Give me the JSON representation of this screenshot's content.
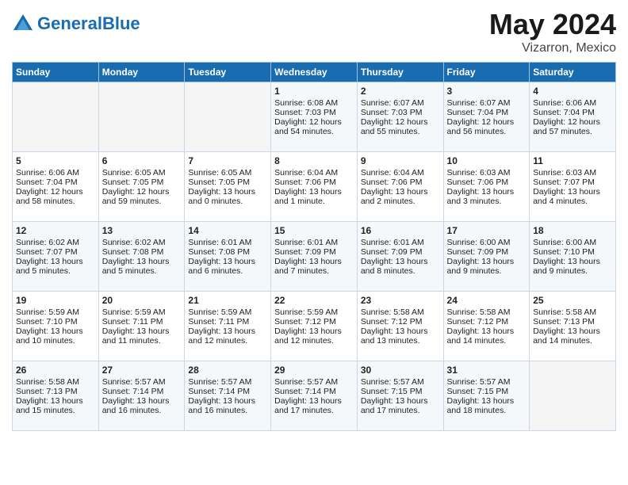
{
  "header": {
    "logo_general": "General",
    "logo_blue": "Blue",
    "month": "May 2024",
    "location": "Vizarron, Mexico"
  },
  "days_of_week": [
    "Sunday",
    "Monday",
    "Tuesday",
    "Wednesday",
    "Thursday",
    "Friday",
    "Saturday"
  ],
  "weeks": [
    [
      {
        "day": "",
        "sunrise": "",
        "sunset": "",
        "daylight": "",
        "empty": true
      },
      {
        "day": "",
        "sunrise": "",
        "sunset": "",
        "daylight": "",
        "empty": true
      },
      {
        "day": "",
        "sunrise": "",
        "sunset": "",
        "daylight": "",
        "empty": true
      },
      {
        "day": "1",
        "sunrise": "Sunrise: 6:08 AM",
        "sunset": "Sunset: 7:03 PM",
        "daylight": "Daylight: 12 hours and 54 minutes."
      },
      {
        "day": "2",
        "sunrise": "Sunrise: 6:07 AM",
        "sunset": "Sunset: 7:03 PM",
        "daylight": "Daylight: 12 hours and 55 minutes."
      },
      {
        "day": "3",
        "sunrise": "Sunrise: 6:07 AM",
        "sunset": "Sunset: 7:04 PM",
        "daylight": "Daylight: 12 hours and 56 minutes."
      },
      {
        "day": "4",
        "sunrise": "Sunrise: 6:06 AM",
        "sunset": "Sunset: 7:04 PM",
        "daylight": "Daylight: 12 hours and 57 minutes."
      }
    ],
    [
      {
        "day": "5",
        "sunrise": "Sunrise: 6:06 AM",
        "sunset": "Sunset: 7:04 PM",
        "daylight": "Daylight: 12 hours and 58 minutes."
      },
      {
        "day": "6",
        "sunrise": "Sunrise: 6:05 AM",
        "sunset": "Sunset: 7:05 PM",
        "daylight": "Daylight: 12 hours and 59 minutes."
      },
      {
        "day": "7",
        "sunrise": "Sunrise: 6:05 AM",
        "sunset": "Sunset: 7:05 PM",
        "daylight": "Daylight: 13 hours and 0 minutes."
      },
      {
        "day": "8",
        "sunrise": "Sunrise: 6:04 AM",
        "sunset": "Sunset: 7:06 PM",
        "daylight": "Daylight: 13 hours and 1 minute."
      },
      {
        "day": "9",
        "sunrise": "Sunrise: 6:04 AM",
        "sunset": "Sunset: 7:06 PM",
        "daylight": "Daylight: 13 hours and 2 minutes."
      },
      {
        "day": "10",
        "sunrise": "Sunrise: 6:03 AM",
        "sunset": "Sunset: 7:06 PM",
        "daylight": "Daylight: 13 hours and 3 minutes."
      },
      {
        "day": "11",
        "sunrise": "Sunrise: 6:03 AM",
        "sunset": "Sunset: 7:07 PM",
        "daylight": "Daylight: 13 hours and 4 minutes."
      }
    ],
    [
      {
        "day": "12",
        "sunrise": "Sunrise: 6:02 AM",
        "sunset": "Sunset: 7:07 PM",
        "daylight": "Daylight: 13 hours and 5 minutes."
      },
      {
        "day": "13",
        "sunrise": "Sunrise: 6:02 AM",
        "sunset": "Sunset: 7:08 PM",
        "daylight": "Daylight: 13 hours and 5 minutes."
      },
      {
        "day": "14",
        "sunrise": "Sunrise: 6:01 AM",
        "sunset": "Sunset: 7:08 PM",
        "daylight": "Daylight: 13 hours and 6 minutes."
      },
      {
        "day": "15",
        "sunrise": "Sunrise: 6:01 AM",
        "sunset": "Sunset: 7:09 PM",
        "daylight": "Daylight: 13 hours and 7 minutes."
      },
      {
        "day": "16",
        "sunrise": "Sunrise: 6:01 AM",
        "sunset": "Sunset: 7:09 PM",
        "daylight": "Daylight: 13 hours and 8 minutes."
      },
      {
        "day": "17",
        "sunrise": "Sunrise: 6:00 AM",
        "sunset": "Sunset: 7:09 PM",
        "daylight": "Daylight: 13 hours and 9 minutes."
      },
      {
        "day": "18",
        "sunrise": "Sunrise: 6:00 AM",
        "sunset": "Sunset: 7:10 PM",
        "daylight": "Daylight: 13 hours and 9 minutes."
      }
    ],
    [
      {
        "day": "19",
        "sunrise": "Sunrise: 5:59 AM",
        "sunset": "Sunset: 7:10 PM",
        "daylight": "Daylight: 13 hours and 10 minutes."
      },
      {
        "day": "20",
        "sunrise": "Sunrise: 5:59 AM",
        "sunset": "Sunset: 7:11 PM",
        "daylight": "Daylight: 13 hours and 11 minutes."
      },
      {
        "day": "21",
        "sunrise": "Sunrise: 5:59 AM",
        "sunset": "Sunset: 7:11 PM",
        "daylight": "Daylight: 13 hours and 12 minutes."
      },
      {
        "day": "22",
        "sunrise": "Sunrise: 5:59 AM",
        "sunset": "Sunset: 7:12 PM",
        "daylight": "Daylight: 13 hours and 12 minutes."
      },
      {
        "day": "23",
        "sunrise": "Sunrise: 5:58 AM",
        "sunset": "Sunset: 7:12 PM",
        "daylight": "Daylight: 13 hours and 13 minutes."
      },
      {
        "day": "24",
        "sunrise": "Sunrise: 5:58 AM",
        "sunset": "Sunset: 7:12 PM",
        "daylight": "Daylight: 13 hours and 14 minutes."
      },
      {
        "day": "25",
        "sunrise": "Sunrise: 5:58 AM",
        "sunset": "Sunset: 7:13 PM",
        "daylight": "Daylight: 13 hours and 14 minutes."
      }
    ],
    [
      {
        "day": "26",
        "sunrise": "Sunrise: 5:58 AM",
        "sunset": "Sunset: 7:13 PM",
        "daylight": "Daylight: 13 hours and 15 minutes."
      },
      {
        "day": "27",
        "sunrise": "Sunrise: 5:57 AM",
        "sunset": "Sunset: 7:14 PM",
        "daylight": "Daylight: 13 hours and 16 minutes."
      },
      {
        "day": "28",
        "sunrise": "Sunrise: 5:57 AM",
        "sunset": "Sunset: 7:14 PM",
        "daylight": "Daylight: 13 hours and 16 minutes."
      },
      {
        "day": "29",
        "sunrise": "Sunrise: 5:57 AM",
        "sunset": "Sunset: 7:14 PM",
        "daylight": "Daylight: 13 hours and 17 minutes."
      },
      {
        "day": "30",
        "sunrise": "Sunrise: 5:57 AM",
        "sunset": "Sunset: 7:15 PM",
        "daylight": "Daylight: 13 hours and 17 minutes."
      },
      {
        "day": "31",
        "sunrise": "Sunrise: 5:57 AM",
        "sunset": "Sunset: 7:15 PM",
        "daylight": "Daylight: 13 hours and 18 minutes."
      },
      {
        "day": "",
        "sunrise": "",
        "sunset": "",
        "daylight": "",
        "empty": true
      }
    ]
  ]
}
